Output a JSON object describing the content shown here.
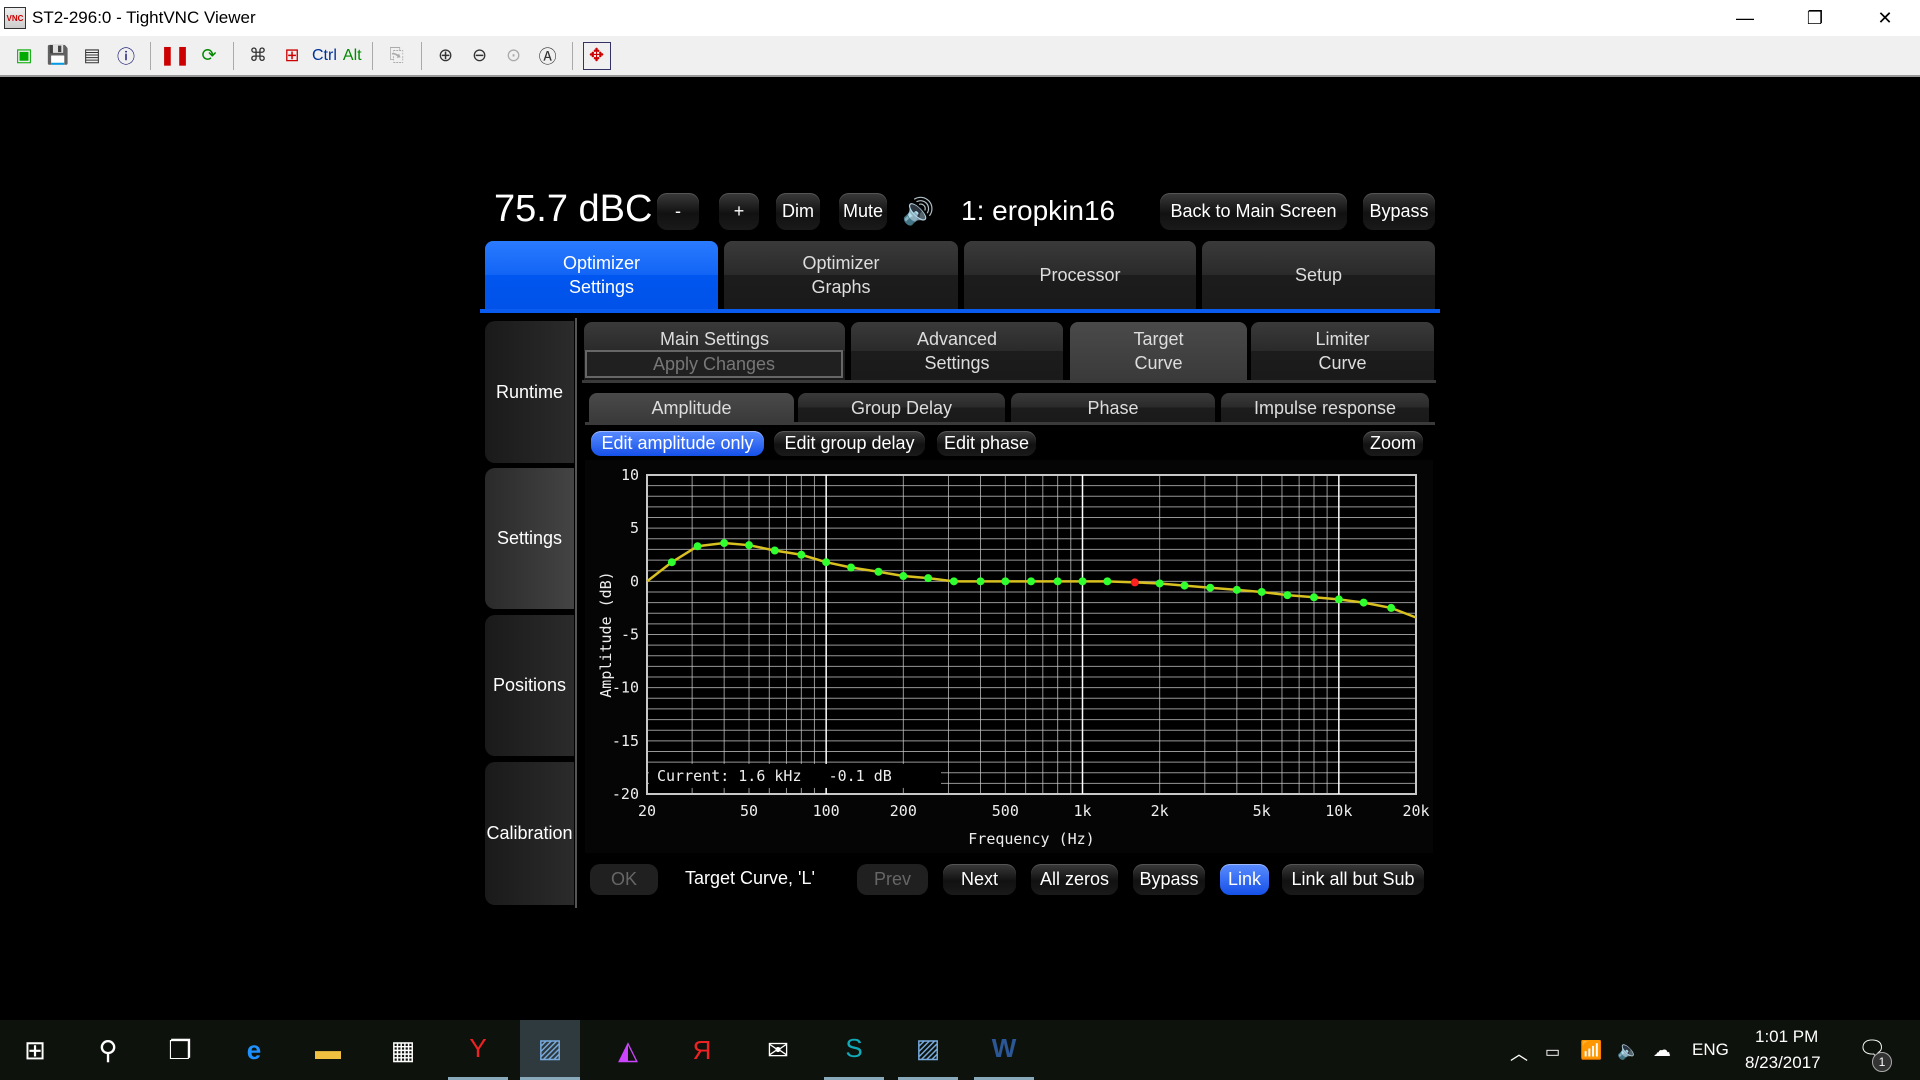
{
  "window": {
    "title": "ST2-296:0 - TightVNC Viewer",
    "toolbar_ctrl": "Ctrl",
    "toolbar_alt": "Alt"
  },
  "header": {
    "level": "75.7 dBC",
    "minus": "-",
    "plus": "+",
    "dim": "Dim",
    "mute": "Mute",
    "preset": "1: eropkin16",
    "back": "Back to Main Screen",
    "bypass": "Bypass"
  },
  "main_tabs": [
    {
      "label": "Optimizer\nSettings",
      "active": true
    },
    {
      "label": "Optimizer\nGraphs"
    },
    {
      "label": "Processor"
    },
    {
      "label": "Setup"
    }
  ],
  "sidebar": [
    {
      "label": "Runtime"
    },
    {
      "label": "Settings",
      "selected": true
    },
    {
      "label": "Positions"
    },
    {
      "label": "Calibration"
    }
  ],
  "sub_tabs": {
    "main_settings": "Main Settings",
    "apply_changes": "Apply Changes",
    "advanced": "Advanced\nSettings",
    "target": "Target\nCurve",
    "limiter": "Limiter\nCurve"
  },
  "graph_tabs": [
    "Amplitude",
    "Group Delay",
    "Phase",
    "Impulse response"
  ],
  "edit_modes": {
    "amp": "Edit amplitude only",
    "gd": "Edit group delay",
    "phase": "Edit phase",
    "zoom": "Zoom"
  },
  "bottom": {
    "ok": "OK",
    "label": "Target Curve, 'L'",
    "prev": "Prev",
    "next": "Next",
    "zeros": "All zeros",
    "bypass": "Bypass",
    "link": "Link",
    "link_all": "Link all but Sub"
  },
  "chart_data": {
    "type": "line",
    "xlabel": "Frequency (Hz)",
    "ylabel": "Amplitude (dB)",
    "xscale": "log",
    "xlim": [
      20,
      20000
    ],
    "ylim": [
      -20,
      10
    ],
    "grid": true,
    "xticks": [
      20,
      50,
      100,
      200,
      500,
      1000,
      2000,
      5000,
      10000,
      20000
    ],
    "xtick_labels": [
      "20",
      "50",
      "100",
      "200",
      "500",
      "1k",
      "2k",
      "5k",
      "10k",
      "20k"
    ],
    "yticks": [
      10,
      5,
      0,
      -5,
      -10,
      -15,
      -20
    ],
    "ytick_labels": [
      "10",
      "5",
      "0",
      "-5",
      "-10",
      "-15",
      "-20"
    ],
    "curve": {
      "x": [
        20,
        25,
        31.5,
        40,
        50,
        63,
        80,
        100,
        125,
        160,
        200,
        250,
        315,
        400,
        500,
        630,
        800,
        1000,
        1250,
        1600,
        2000,
        2500,
        3150,
        4000,
        5000,
        6300,
        8000,
        10000,
        12500,
        16000,
        20000
      ],
      "y": [
        0,
        1.8,
        3.3,
        3.6,
        3.4,
        2.9,
        2.5,
        1.8,
        1.3,
        0.9,
        0.5,
        0.3,
        0,
        0,
        0,
        0,
        0,
        0,
        0,
        -0.1,
        -0.2,
        -0.4,
        -0.6,
        -0.8,
        -1.0,
        -1.3,
        -1.5,
        -1.7,
        -2.0,
        -2.5,
        -3.4
      ]
    },
    "points": {
      "x": [
        25,
        31.5,
        40,
        50,
        63,
        80,
        100,
        125,
        160,
        200,
        250,
        315,
        400,
        500,
        630,
        800,
        1000,
        1250,
        1600,
        2000,
        2500,
        3150,
        4000,
        5000,
        6300,
        8000,
        10000,
        12500,
        16000
      ],
      "y": [
        1.8,
        3.3,
        3.6,
        3.4,
        2.9,
        2.5,
        1.8,
        1.3,
        0.9,
        0.5,
        0.3,
        0,
        0,
        0,
        0,
        0,
        0,
        0,
        -0.1,
        -0.2,
        -0.4,
        -0.6,
        -0.8,
        -1.0,
        -1.3,
        -1.5,
        -1.7,
        -2.0,
        -2.5
      ]
    },
    "selected_x": 1600,
    "current_text": "Current: 1.6 kHz   -0.1 dB",
    "colors": {
      "curve": "#d8c020",
      "point": "#30ff30",
      "selected": "#ff2020",
      "grid": "#c8c8c8"
    }
  },
  "taskbar": {
    "lang": "ENG",
    "time": "1:01 PM",
    "date": "8/23/2017",
    "notifications": "1"
  }
}
